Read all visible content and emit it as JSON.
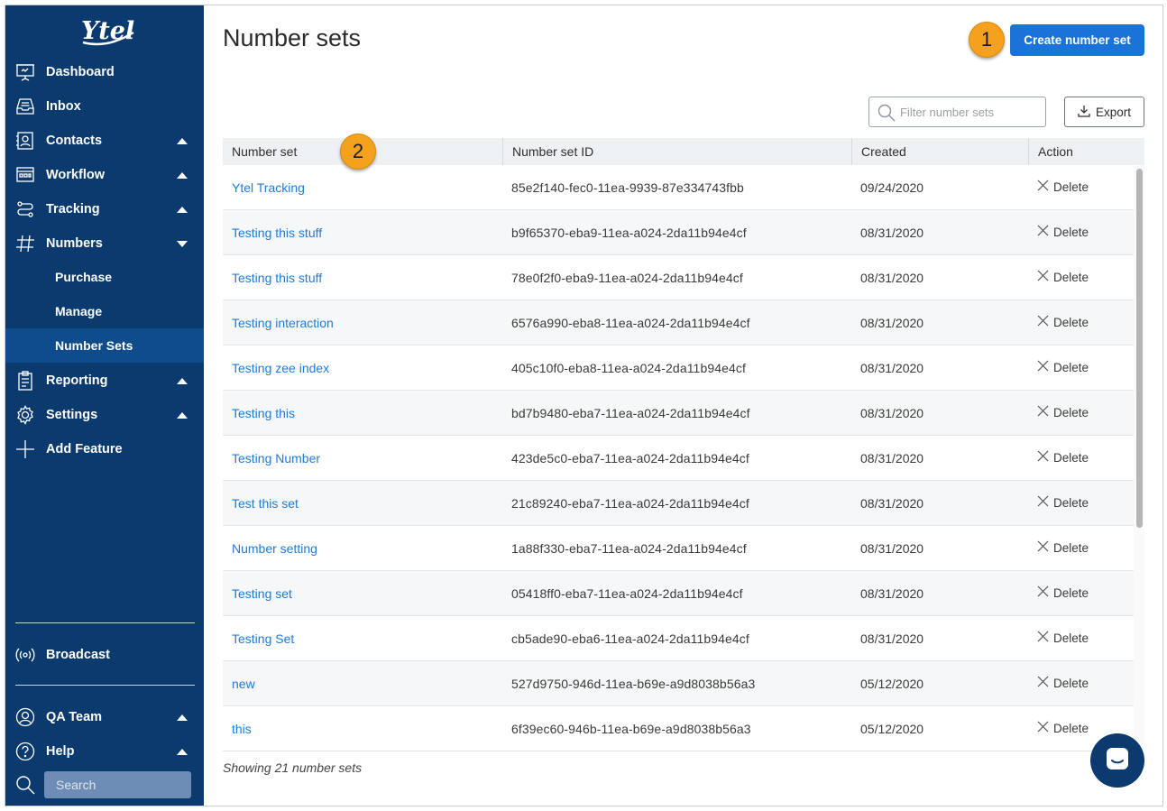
{
  "app": {
    "logo_text": "Ytel",
    "brand_color": "#0b3a6e",
    "accent_color": "#1a73d9",
    "link_color": "#1f7bd8"
  },
  "sidebar": {
    "items": [
      {
        "label": "Dashboard",
        "icon": "dashboard-icon"
      },
      {
        "label": "Inbox",
        "icon": "inbox-icon"
      },
      {
        "label": "Contacts",
        "icon": "contacts-icon",
        "caret": "up"
      },
      {
        "label": "Workflow",
        "icon": "workflow-icon",
        "caret": "up"
      },
      {
        "label": "Tracking",
        "icon": "tracking-icon",
        "caret": "up"
      },
      {
        "label": "Numbers",
        "icon": "hash-icon",
        "caret": "down"
      },
      {
        "label": "Reporting",
        "icon": "clipboard-icon",
        "caret": "up"
      },
      {
        "label": "Settings",
        "icon": "gear-icon",
        "caret": "up"
      },
      {
        "label": "Add Feature",
        "icon": "plus-icon"
      }
    ],
    "numbers_sub": [
      {
        "label": "Purchase"
      },
      {
        "label": "Manage"
      },
      {
        "label": "Number Sets",
        "active": true
      }
    ],
    "broadcast": "Broadcast",
    "team": "QA Team",
    "help": "Help",
    "search_placeholder": "Search"
  },
  "main": {
    "title": "Number sets",
    "create_button": "Create number set",
    "marker_1": "1",
    "marker_2": "2",
    "filter_placeholder": "Filter number sets",
    "export_button": "Export",
    "columns": [
      "Number set",
      "Number set ID",
      "Created",
      "Action"
    ],
    "rows": [
      {
        "name": "Ytel Tracking",
        "id": "85e2f140-fec0-11ea-9939-87e334743fbb",
        "created": "09/24/2020",
        "action": "Delete"
      },
      {
        "name": "Testing this stuff",
        "id": "b9f65370-eba9-11ea-a024-2da11b94e4cf",
        "created": "08/31/2020",
        "action": "Delete"
      },
      {
        "name": "Testing this stuff",
        "id": "78e0f2f0-eba9-11ea-a024-2da11b94e4cf",
        "created": "08/31/2020",
        "action": "Delete"
      },
      {
        "name": "Testing interaction",
        "id": "6576a990-eba8-11ea-a024-2da11b94e4cf",
        "created": "08/31/2020",
        "action": "Delete"
      },
      {
        "name": "Testing zee index",
        "id": "405c10f0-eba8-11ea-a024-2da11b94e4cf",
        "created": "08/31/2020",
        "action": "Delete"
      },
      {
        "name": "Testing this",
        "id": "bd7b9480-eba7-11ea-a024-2da11b94e4cf",
        "created": "08/31/2020",
        "action": "Delete"
      },
      {
        "name": "Testing Number",
        "id": "423de5c0-eba7-11ea-a024-2da11b94e4cf",
        "created": "08/31/2020",
        "action": "Delete"
      },
      {
        "name": "Test this set",
        "id": "21c89240-eba7-11ea-a024-2da11b94e4cf",
        "created": "08/31/2020",
        "action": "Delete"
      },
      {
        "name": "Number setting",
        "id": "1a88f330-eba7-11ea-a024-2da11b94e4cf",
        "created": "08/31/2020",
        "action": "Delete"
      },
      {
        "name": "Testing set",
        "id": "05418ff0-eba7-11ea-a024-2da11b94e4cf",
        "created": "08/31/2020",
        "action": "Delete"
      },
      {
        "name": "Testing Set",
        "id": "cb5ade90-eba6-11ea-a024-2da11b94e4cf",
        "created": "08/31/2020",
        "action": "Delete"
      },
      {
        "name": "new",
        "id": "527d9750-946d-11ea-b69e-a9d8038b56a3",
        "created": "05/12/2020",
        "action": "Delete"
      },
      {
        "name": "this",
        "id": "6f39ec60-946b-11ea-b69e-a9d8038b56a3",
        "created": "05/12/2020",
        "action": "Delete"
      }
    ],
    "footer": "Showing 21 number sets"
  }
}
